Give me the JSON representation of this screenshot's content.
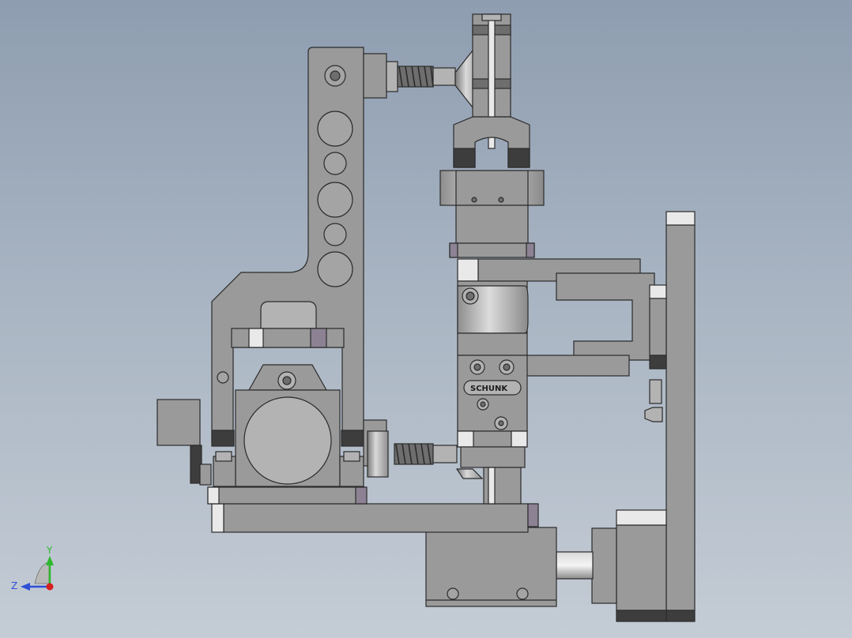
{
  "brand": {
    "label": "SCHUNK"
  },
  "triad": {
    "y_label": "Y",
    "z_label": "Z"
  },
  "colors": {
    "background_top": "#8e9db0",
    "background_bottom": "#c4ccd5",
    "steel": "#9a9a9a",
    "steel_light": "#b3b3b3",
    "steel_dark": "#6e6e6e",
    "accent_purple": "#8c8294",
    "axis_y": "#2db82d",
    "axis_z": "#2f4fd6",
    "axis_origin": "#d61f1f"
  }
}
